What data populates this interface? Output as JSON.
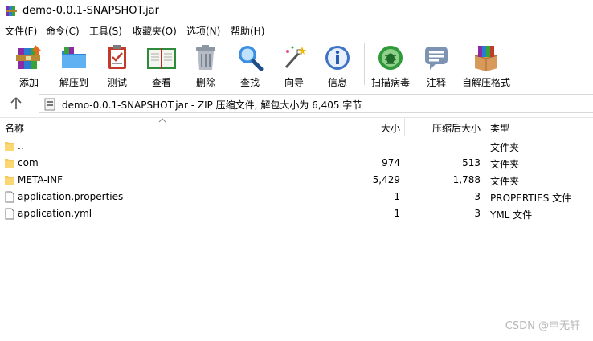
{
  "window": {
    "title": "demo-0.0.1-SNAPSHOT.jar"
  },
  "menu": [
    {
      "label": "文件(F)"
    },
    {
      "label": "命令(C)"
    },
    {
      "label": "工具(S)"
    },
    {
      "label": "收藏夹(O)"
    },
    {
      "label": "选项(N)"
    },
    {
      "label": "帮助(H)"
    }
  ],
  "toolbar": [
    {
      "label": "添加",
      "icon": "add-archive-icon"
    },
    {
      "label": "解压到",
      "icon": "extract-folder-icon"
    },
    {
      "label": "测试",
      "icon": "test-clipboard-icon"
    },
    {
      "label": "查看",
      "icon": "view-book-icon"
    },
    {
      "label": "删除",
      "icon": "trash-icon"
    },
    {
      "label": "查找",
      "icon": "magnifier-icon"
    },
    {
      "label": "向导",
      "icon": "wizard-wand-icon"
    },
    {
      "label": "信息",
      "icon": "info-icon"
    },
    {
      "label": "扫描病毒",
      "icon": "virus-bug-icon"
    },
    {
      "label": "注释",
      "icon": "comment-icon"
    },
    {
      "label": "自解压格式",
      "icon": "sfx-box-icon"
    }
  ],
  "address": {
    "text": "demo-0.0.1-SNAPSHOT.jar - ZIP 压缩文件, 解包大小为 6,405 字节"
  },
  "columns": {
    "name": "名称",
    "size": "大小",
    "packed": "压缩后大小",
    "type": "类型"
  },
  "files": [
    {
      "name": "..",
      "size": "",
      "packed": "",
      "type": "文件夹",
      "kind": "folder"
    },
    {
      "name": "com",
      "size": "974",
      "packed": "513",
      "type": "文件夹",
      "kind": "folder"
    },
    {
      "name": "META-INF",
      "size": "5,429",
      "packed": "1,788",
      "type": "文件夹",
      "kind": "folder"
    },
    {
      "name": "application.properties",
      "size": "1",
      "packed": "3",
      "type": "PROPERTIES 文件",
      "kind": "file"
    },
    {
      "name": "application.yml",
      "size": "1",
      "packed": "3",
      "type": "YML 文件",
      "kind": "file"
    }
  ],
  "watermark": "CSDN @申无轩"
}
